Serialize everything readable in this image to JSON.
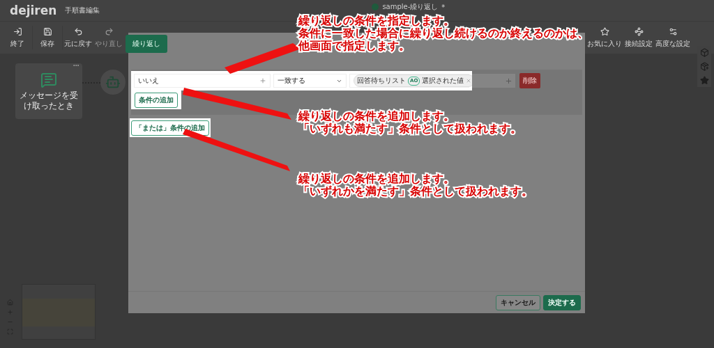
{
  "app": {
    "logo": "dejiren",
    "page_title": "手順書編集",
    "document_title": "sample-繰り返し",
    "unsaved_mark": "*"
  },
  "toolbar": {
    "left": [
      {
        "kind": "exit",
        "label": "終了",
        "disabled": false
      },
      {
        "kind": "save",
        "label": "保存",
        "disabled": false
      },
      {
        "kind": "undo",
        "label": "元に戻す",
        "disabled": false
      },
      {
        "kind": "redo",
        "label": "やり直し",
        "disabled": true
      }
    ],
    "right": [
      {
        "kind": "favorite",
        "label": "お気に入り"
      },
      {
        "kind": "connection",
        "label": "接続設定"
      },
      {
        "kind": "advanced",
        "label": "高度な設定"
      }
    ]
  },
  "canvas": {
    "trigger_node": {
      "label": "メッセージを受け取ったとき"
    }
  },
  "dialog": {
    "tab": "繰り返し",
    "condition": {
      "field": "いいえ",
      "operator": "一致する",
      "chip": {
        "source": "回答待ちリスト",
        "badge": "AO",
        "value": "選択された値"
      },
      "delete": "削除"
    },
    "add_condition": "条件の追加",
    "add_or_condition": "「または」条件の追加",
    "buttons": [
      {
        "kind": "secondary",
        "label": "キャンセル"
      },
      {
        "kind": "primary",
        "label": "決定する"
      }
    ]
  },
  "annotations": [
    {
      "lines": [
        "繰り返しの条件を指定します。",
        "条件に一致した場合に繰り返し続けるのか終えるのかは、",
        "他画面で指定します。"
      ]
    },
    {
      "lines": [
        "繰り返しの条件を追加します。",
        "「いずれも満たす」条件として扱われます。"
      ]
    },
    {
      "lines": [
        "繰り返しの条件を追加します。",
        "「いずれかを満たす」条件として扱われます。"
      ]
    }
  ]
}
